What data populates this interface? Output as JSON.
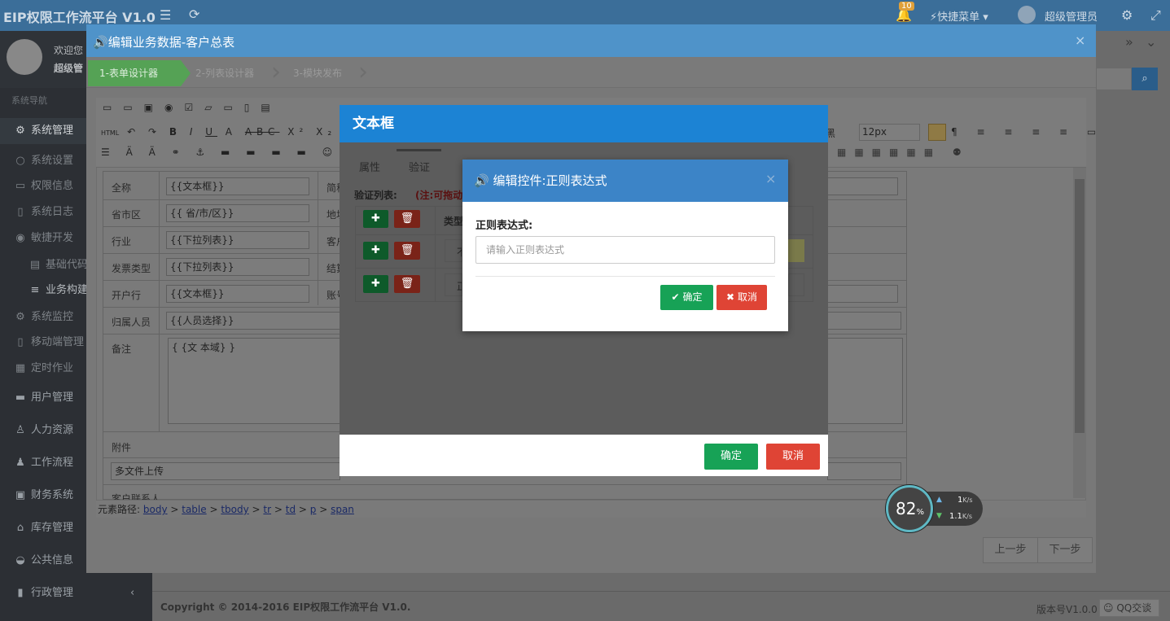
{
  "header": {
    "brand": "EIP权限工作流平台 V1.0",
    "notif_count": "10",
    "quick_menu": "快捷菜单",
    "user": "超级管理员"
  },
  "sidebar": {
    "welcome": "欢迎您",
    "username": "超级管",
    "section": "系统导航",
    "items": [
      {
        "label": "系统管理",
        "icon": "gear"
      },
      {
        "label": "系统设置",
        "icon": "cog"
      },
      {
        "label": "权限信息",
        "icon": "monitor"
      },
      {
        "label": "系统日志",
        "icon": "file"
      },
      {
        "label": "敏捷开发",
        "icon": "eye"
      },
      {
        "label": "基础代码",
        "icon": "doc"
      },
      {
        "label": "业务构建",
        "icon": "db"
      },
      {
        "label": "系统监控",
        "icon": "cogs"
      },
      {
        "label": "移动端管理",
        "icon": "mobile"
      },
      {
        "label": "定时作业",
        "icon": "calendar"
      },
      {
        "label": "用户管理",
        "icon": "idcard"
      },
      {
        "label": "人力资源",
        "icon": "user"
      },
      {
        "label": "工作流程",
        "icon": "users"
      },
      {
        "label": "财务系统",
        "icon": "money"
      },
      {
        "label": "库存管理",
        "icon": "bank"
      },
      {
        "label": "公共信息",
        "icon": "comments"
      },
      {
        "label": "行政管理",
        "icon": "bookmark"
      }
    ]
  },
  "outer": {
    "title": "编辑业务数据-客户总表",
    "steps": [
      "1-表单设计器",
      "2-列表设计器",
      "3-模块发布"
    ],
    "prev": "上一步",
    "next": "下一步"
  },
  "editor": {
    "font_name": "黑",
    "font_size": "12px",
    "fields": [
      {
        "label": "全称",
        "value": "{{文本框}}",
        "label2": "简称"
      },
      {
        "label": "省市区",
        "value": "{{ 省/市/区}}",
        "label2": "地址"
      },
      {
        "label": "行业",
        "value": "{{下拉列表}}",
        "label2": "客户"
      },
      {
        "label": "发票类型",
        "value": "{{下拉列表}}",
        "label2": "结算"
      },
      {
        "label": "开户行",
        "value": "{{文本框}}",
        "label2": "账号"
      },
      {
        "label": "归属人员",
        "value": "{{人员选择}}"
      },
      {
        "label": "备注",
        "value": "{ {文 本域} }"
      }
    ],
    "attach_label": "附件",
    "upload": "多文件上传",
    "contact": "客户联系人",
    "path_label": "元素路径:",
    "path": [
      "body",
      "table",
      "tbody",
      "tr",
      "td",
      "p",
      "span"
    ]
  },
  "mid": {
    "title": "文本框",
    "tabs": [
      "属性",
      "验证"
    ],
    "list_label": "验证列表:",
    "note": "(注:可拖动",
    "col_type": "类型",
    "row1": "不",
    "row2": "正",
    "ok": "确定",
    "cancel": "取消"
  },
  "inner": {
    "title": "编辑控件:正则表达式",
    "field_label": "正则表达式:",
    "placeholder": "请输入正则表达式",
    "ok": "确定",
    "cancel": "取消"
  },
  "speed": {
    "percent": "82",
    "pct_sign": "%",
    "up": "1",
    "up_unit": "K/s",
    "down": "1.1",
    "down_unit": "K/s"
  },
  "footer": {
    "copyright": "Copyright © 2014-2016 EIP权限工作流平台 V1.0.",
    "version": "版本号V1.0.0",
    "qq": "QQ交谈"
  }
}
